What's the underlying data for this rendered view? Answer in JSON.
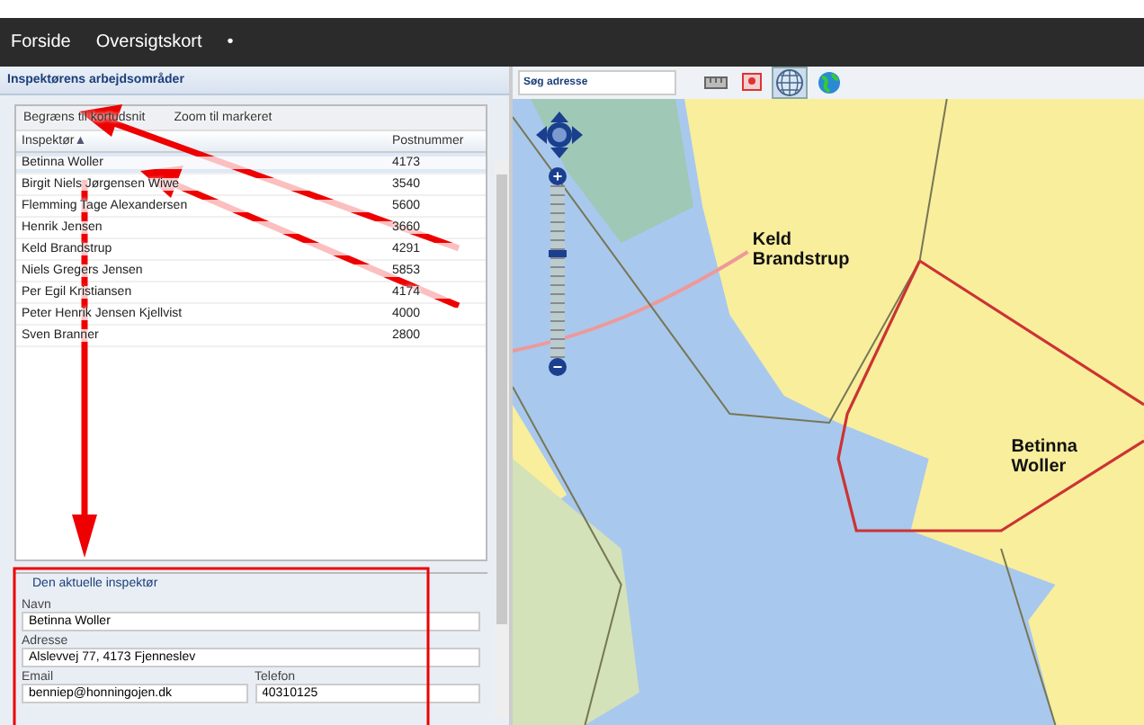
{
  "nav": {
    "items": [
      {
        "label": "Forside"
      },
      {
        "label": "Oversigtskort"
      },
      {
        "label": "•"
      }
    ]
  },
  "panel": {
    "title": "Inspektørens arbejdsområder",
    "toolbar": [
      {
        "label": "Begræns til kortudsnit"
      },
      {
        "label": "Zoom til markeret"
      }
    ],
    "table": {
      "columns": [
        {
          "label": "Inspektør",
          "sort": "▲"
        },
        {
          "label": "Postnummer"
        }
      ],
      "rows": [
        {
          "name": "Betinna Woller",
          "postnr": "4173",
          "selected": true
        },
        {
          "name": "Birgit Niels Jørgensen Wiwe",
          "postnr": "3540",
          "selected": false
        },
        {
          "name": "Flemming Tage Alexandersen",
          "postnr": "5600",
          "selected": false
        },
        {
          "name": "Henrik Jensen",
          "postnr": "3660",
          "selected": false
        },
        {
          "name": "Keld Brandstrup",
          "postnr": "4291",
          "selected": false
        },
        {
          "name": "Niels Gregers Jensen",
          "postnr": "5853",
          "selected": false
        },
        {
          "name": "Per Egil Kristiansen",
          "postnr": "4174",
          "selected": false
        },
        {
          "name": "Peter Henrik Jensen Kjellvist",
          "postnr": "4000",
          "selected": false
        },
        {
          "name": "Sven Branner",
          "postnr": "2800",
          "selected": false
        }
      ]
    },
    "details": {
      "legend": "Den aktuelle inspektør",
      "fields": [
        {
          "label": "Navn",
          "value": "Betinna Woller"
        },
        {
          "label": "Adresse",
          "value": "Alslevvej 77, 4173 Fjenneslev"
        }
      ],
      "pair": [
        {
          "label": "Email",
          "value": "benniep@honningojen.dk"
        },
        {
          "label": "Telefon",
          "value": "40310125"
        }
      ]
    }
  },
  "map": {
    "search": {
      "placeholder": "Søg adresse"
    },
    "tools": [
      {
        "kind": "ruler",
        "selected": false
      },
      {
        "kind": "pin",
        "selected": false
      },
      {
        "kind": "grid",
        "selected": true
      },
      {
        "kind": "globe",
        "selected": false
      }
    ],
    "zoom": {
      "in": "+",
      "out": "−",
      "level": 0.58
    },
    "labels": [
      {
        "text": "Keld\nBrandstrup"
      },
      {
        "text": "Betinna\nWoller"
      }
    ]
  }
}
